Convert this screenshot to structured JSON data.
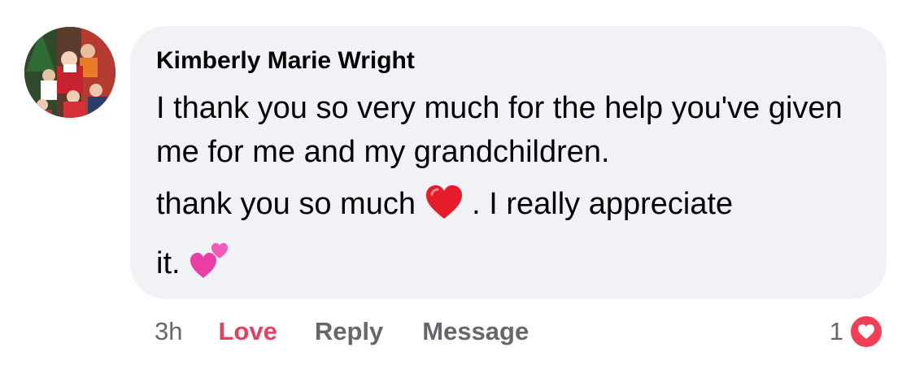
{
  "comment": {
    "author": "Kimberly Marie Wright",
    "paragraph1": "I thank you so very much for the help you've given me for me and my grandchildren.",
    "paragraph2_part1": "thank you so much",
    "paragraph2_part2": ". I really appreciate",
    "paragraph2_part3": "it.",
    "emoji_1": "red-heart",
    "emoji_2": "two-hearts"
  },
  "actions": {
    "time": "3h",
    "love_label": "Love",
    "reply_label": "Reply",
    "message_label": "Message"
  },
  "reactions": {
    "count": "1",
    "icon": "love-heart-icon"
  },
  "colors": {
    "bubble": "#f0f2f5",
    "love_text": "#e4405f",
    "muted_text": "#65676b",
    "love_badge": "#f33e58"
  }
}
